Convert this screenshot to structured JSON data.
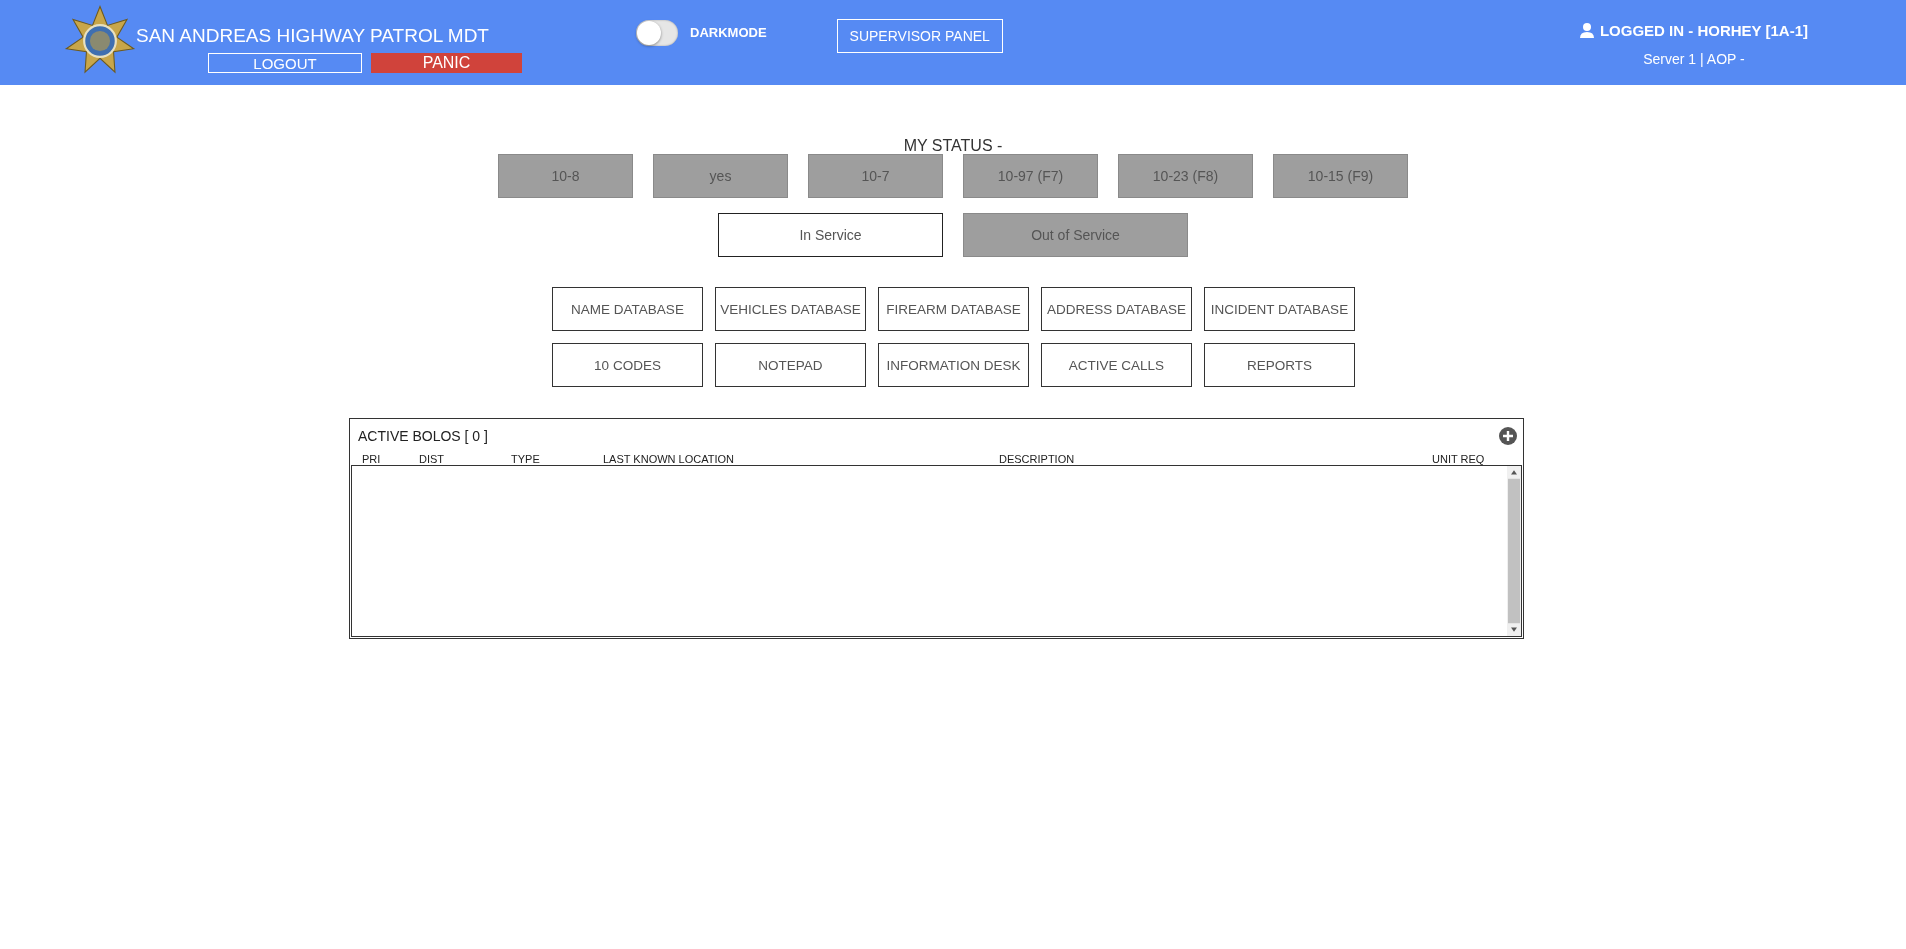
{
  "header": {
    "title": "SAN ANDREAS HIGHWAY PATROL MDT",
    "logout": "LOGOUT",
    "panic": "PANIC",
    "darkmode": {
      "label": "DARKMODE",
      "on": false
    },
    "supervisor_panel": "SUPERVISOR PANEL",
    "logged_in": "LOGGED IN - HORHEY [1A-1]",
    "server": "Server 1 | AOP -"
  },
  "status": {
    "title": "MY STATUS -",
    "codes": [
      "10-8",
      "yes",
      "10-7",
      "10-97 (F7)",
      "10-23 (F8)",
      "10-15 (F9)"
    ],
    "service": [
      {
        "label": "In Service",
        "selected": true
      },
      {
        "label": "Out of Service",
        "selected": false
      }
    ]
  },
  "tools": [
    "NAME DATABASE",
    "VEHICLES DATABASE",
    "FIREARM DATABASE",
    "ADDRESS DATABASE",
    "INCIDENT DATABASE",
    "10 CODES",
    "NOTEPAD",
    "INFORMATION DESK",
    "ACTIVE CALLS",
    "REPORTS"
  ],
  "bolos": {
    "title": "ACTIVE BOLOS [ 0 ]",
    "columns": [
      "PRI",
      "DIST",
      "TYPE",
      "LAST KNOWN LOCATION",
      "DESCRIPTION",
      "UNIT REQ"
    ]
  }
}
